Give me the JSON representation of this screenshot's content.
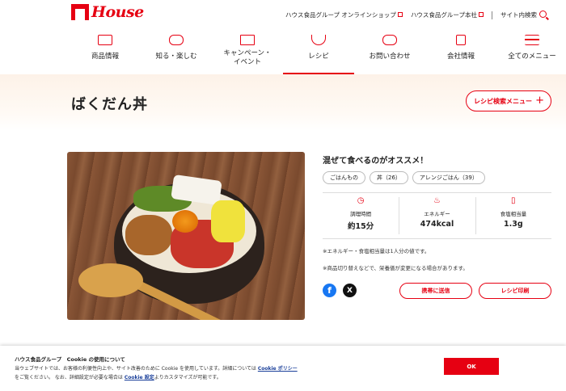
{
  "header": {
    "logo_text": "House",
    "links": [
      "ハウス食品グループ オンラインショップ",
      "ハウス食品グループ本社"
    ],
    "search_label": "サイト内検索"
  },
  "nav": [
    {
      "label": "商品情報",
      "icon": "products-icon"
    },
    {
      "label": "知る・楽しむ",
      "icon": "learn-icon"
    },
    {
      "label": "キャンペーン・\nイベント",
      "icon": "campaign-icon"
    },
    {
      "label": "レシピ",
      "icon": "recipe-icon",
      "active": true
    },
    {
      "label": "お問い合わせ",
      "icon": "contact-icon"
    },
    {
      "label": "会社情報",
      "icon": "company-icon"
    },
    {
      "label": "全てのメニュー",
      "icon": "hamburger-menu-icon"
    }
  ],
  "page": {
    "title": "ばくだん丼",
    "menu_button": "レシピ検索メニュー"
  },
  "recipe": {
    "catch": "混ぜて食べるのがオススメ！",
    "tags": [
      "ごはんもの",
      "丼（26）",
      "アレンジごはん（39）"
    ],
    "stats": {
      "time_label": "調理時間",
      "time_value": "約15分",
      "energy_label": "エネルギー",
      "energy_value": "474kcal",
      "salt_label": "食塩相当量",
      "salt_value": "1.3g"
    },
    "note1": "※エネルギー・食塩相当量は1人分の値です。",
    "note2": "※商品切り替えなどで、栄養価が変更になる場合があります。",
    "mobile_button": "携帯に送信",
    "print_button": "レシピ印刷"
  },
  "cookie": {
    "title": "ハウス食品グループ　Cookie の使用について",
    "text1": "当ウェブサイトでは、お客様の利便性向上や、サイト改善のために Cookie を使用しています。詳細については",
    "policy_link": "Cookie ポリシー",
    "text2": "をご覧ください。 なお、詳細設定が必要な場合は",
    "settings_link": "Cookie 設定",
    "text3": "よりカスタマイズが可能です。",
    "ok_label": "OK"
  },
  "colors": {
    "accent": "#e60012"
  }
}
